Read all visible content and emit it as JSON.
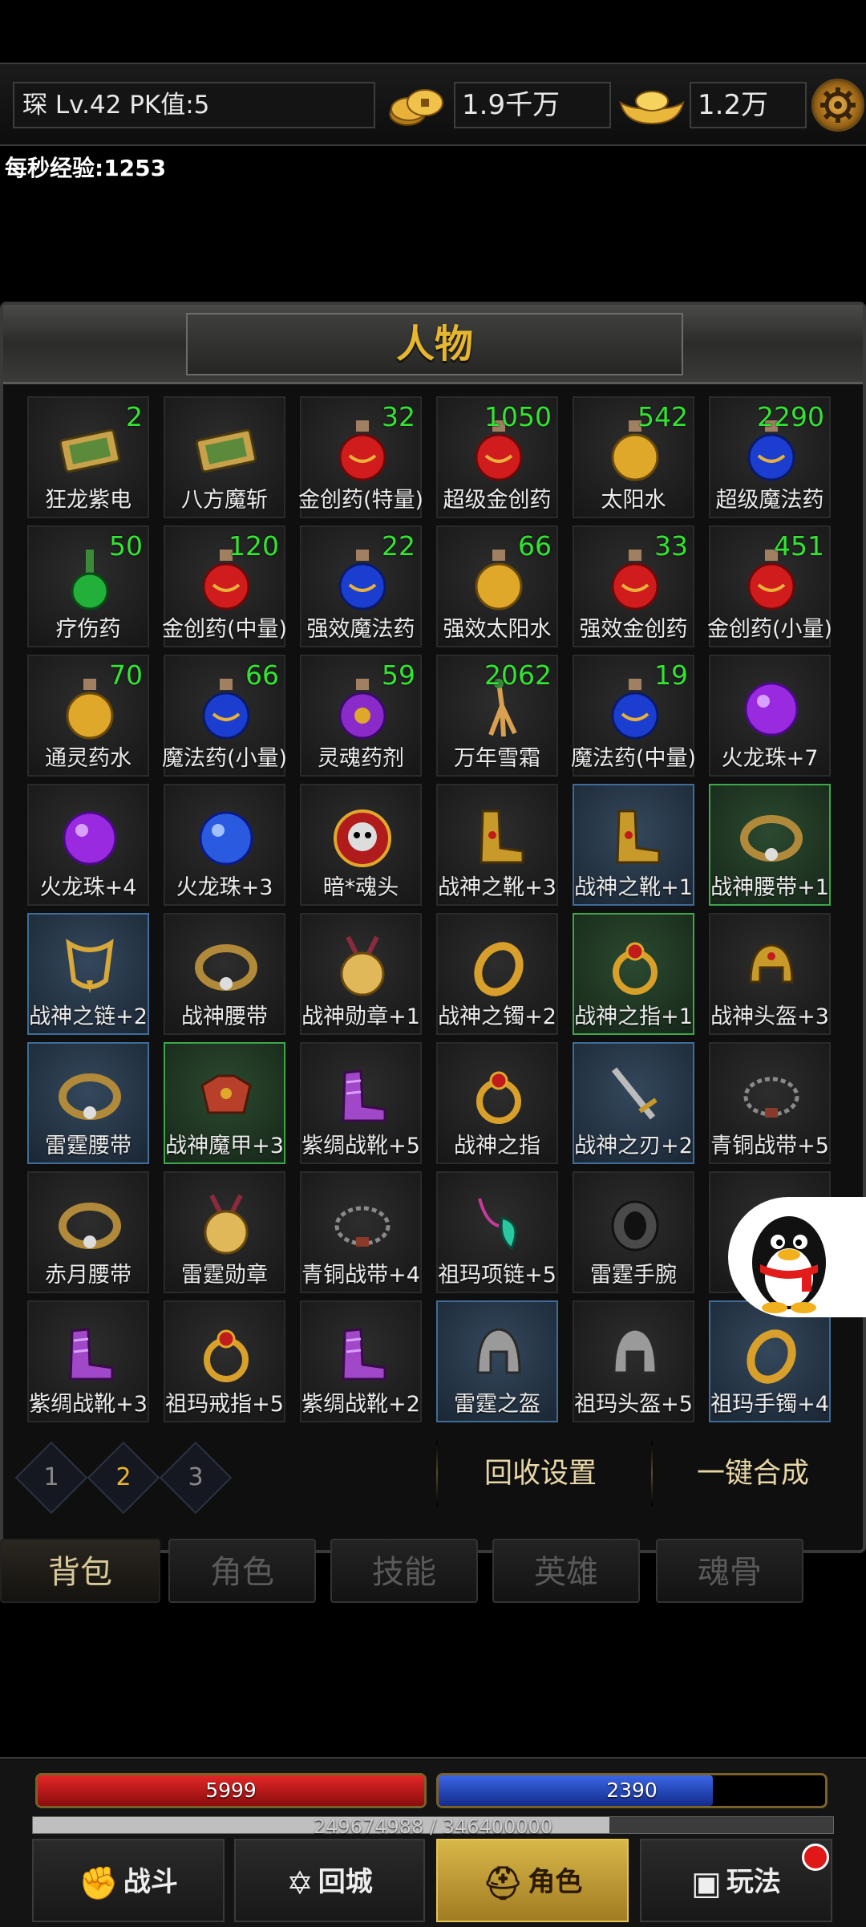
{
  "topbar": {
    "player": "琛  Lv.42 PK值:5",
    "gold": "1.9千万",
    "ingot": "1.2万",
    "icons": {
      "gold": "gold-coins-icon",
      "ingot": "gold-ingot-icon",
      "settings": "gear-icon"
    }
  },
  "exp_rate": "每秒经验:1253",
  "panel": {
    "title": "人物",
    "items": [
      {
        "name": "狂龙紫电",
        "count": "2",
        "icon": "scroll",
        "frame": "normal"
      },
      {
        "name": "八方魔斩",
        "count": "",
        "icon": "scroll",
        "frame": "normal"
      },
      {
        "name": "金创药(特量)",
        "count": "32",
        "icon": "potion-red",
        "frame": "normal"
      },
      {
        "name": "超级金创药",
        "count": "1050",
        "icon": "potion-red",
        "frame": "normal"
      },
      {
        "name": "太阳水",
        "count": "542",
        "icon": "potion-gold",
        "frame": "normal"
      },
      {
        "name": "超级魔法药",
        "count": "2290",
        "icon": "potion-blue",
        "frame": "normal"
      },
      {
        "name": "疗伤药",
        "count": "50",
        "icon": "potion-green",
        "frame": "normal"
      },
      {
        "name": "金创药(中量)",
        "count": "120",
        "icon": "potion-red",
        "frame": "normal"
      },
      {
        "name": "强效魔法药",
        "count": "22",
        "icon": "potion-blue",
        "frame": "normal"
      },
      {
        "name": "强效太阳水",
        "count": "66",
        "icon": "potion-gold",
        "frame": "normal"
      },
      {
        "name": "强效金创药",
        "count": "33",
        "icon": "potion-red",
        "frame": "normal"
      },
      {
        "name": "金创药(小量)",
        "count": "451",
        "icon": "potion-red",
        "frame": "normal"
      },
      {
        "name": "通灵药水",
        "count": "70",
        "icon": "potion-gold",
        "frame": "normal"
      },
      {
        "name": "魔法药(小量)",
        "count": "66",
        "icon": "potion-blue",
        "frame": "normal"
      },
      {
        "name": "灵魂药剂",
        "count": "59",
        "icon": "potion-purple",
        "frame": "normal"
      },
      {
        "name": "万年雪霜",
        "count": "2062",
        "icon": "root",
        "frame": "normal"
      },
      {
        "name": "魔法药(中量)",
        "count": "19",
        "icon": "potion-blue",
        "frame": "normal"
      },
      {
        "name": "火龙珠+7",
        "count": "",
        "icon": "orb-purple",
        "frame": "normal"
      },
      {
        "name": "火龙珠+4",
        "count": "",
        "icon": "orb-purple",
        "frame": "normal"
      },
      {
        "name": "火龙珠+3",
        "count": "",
        "icon": "orb-blue",
        "frame": "normal"
      },
      {
        "name": "暗*魂头",
        "count": "",
        "icon": "skull",
        "frame": "normal"
      },
      {
        "name": "战神之靴+3",
        "count": "",
        "icon": "boots-gold",
        "frame": "normal"
      },
      {
        "name": "战神之靴+1",
        "count": "",
        "icon": "boots-gold",
        "frame": "blue"
      },
      {
        "name": "战神腰带+1",
        "count": "",
        "icon": "belt",
        "frame": "green"
      },
      {
        "name": "战神之链+2",
        "count": "",
        "icon": "necklace",
        "frame": "blue"
      },
      {
        "name": "战神腰带",
        "count": "",
        "icon": "belt",
        "frame": "normal"
      },
      {
        "name": "战神勋章+1",
        "count": "",
        "icon": "medal",
        "frame": "normal"
      },
      {
        "name": "战神之镯+2",
        "count": "",
        "icon": "bracelet",
        "frame": "normal"
      },
      {
        "name": "战神之指+1",
        "count": "",
        "icon": "ring",
        "frame": "green"
      },
      {
        "name": "战神头盔+3",
        "count": "",
        "icon": "helmet-gold",
        "frame": "normal"
      },
      {
        "name": "雷霆腰带",
        "count": "",
        "icon": "belt",
        "frame": "blue"
      },
      {
        "name": "战神魔甲+3",
        "count": "",
        "icon": "armor",
        "frame": "green"
      },
      {
        "name": "紫绸战靴+5",
        "count": "",
        "icon": "boots-purple",
        "frame": "normal"
      },
      {
        "name": "战神之指",
        "count": "",
        "icon": "ring",
        "frame": "normal"
      },
      {
        "name": "战神之刃+2",
        "count": "",
        "icon": "sword",
        "frame": "blue"
      },
      {
        "name": "青铜战带+5",
        "count": "",
        "icon": "chain-belt",
        "frame": "normal"
      },
      {
        "name": "赤月腰带",
        "count": "",
        "icon": "belt",
        "frame": "normal"
      },
      {
        "name": "雷霆勋章",
        "count": "",
        "icon": "medal",
        "frame": "normal"
      },
      {
        "name": "青铜战带+4",
        "count": "",
        "icon": "chain-belt",
        "frame": "normal"
      },
      {
        "name": "祖玛项链+5",
        "count": "",
        "icon": "pendant",
        "frame": "normal"
      },
      {
        "name": "雷霆手腕",
        "count": "",
        "icon": "bracer",
        "frame": "normal"
      },
      {
        "name": "",
        "count": "",
        "icon": "",
        "frame": "normal"
      },
      {
        "name": "紫绸战靴+3",
        "count": "",
        "icon": "boots-purple",
        "frame": "normal"
      },
      {
        "name": "祖玛戒指+5",
        "count": "",
        "icon": "ring",
        "frame": "normal"
      },
      {
        "name": "紫绸战靴+2",
        "count": "",
        "icon": "boots-purple",
        "frame": "normal"
      },
      {
        "name": "雷霆之盔",
        "count": "",
        "icon": "helmet-silver",
        "frame": "blue"
      },
      {
        "name": "祖玛头盔+5",
        "count": "",
        "icon": "helmet-silver",
        "frame": "normal"
      },
      {
        "name": "祖玛手镯+4",
        "count": "",
        "icon": "bracelet",
        "frame": "blue"
      }
    ],
    "pages": [
      "1",
      "2",
      "3"
    ],
    "active_page": "2",
    "recycle_label": "回收设置",
    "combine_label": "一键合成"
  },
  "tabs": [
    {
      "label": "背包",
      "active": true
    },
    {
      "label": "角色",
      "active": false
    },
    {
      "label": "技能",
      "active": false
    },
    {
      "label": "英雄",
      "active": false
    },
    {
      "label": "魂骨",
      "active": false
    }
  ],
  "hud": {
    "hp": "5999",
    "mp": "2390",
    "hp_fraction": 1.0,
    "mp_fraction": 0.71,
    "exp": "249674988 / 346400000",
    "exp_fraction": 0.72,
    "nav": [
      {
        "label": "战斗",
        "icon": "fist-icon",
        "active": false
      },
      {
        "label": "回城",
        "icon": "portal-icon",
        "active": false
      },
      {
        "label": "角色",
        "icon": "helmet-icon",
        "active": true
      },
      {
        "label": "玩法",
        "icon": "treasure-chest-icon",
        "active": false
      }
    ]
  },
  "colors": {
    "accent_gold": "#e6b630",
    "count_green": "#33e433",
    "hp_red": "#c81818",
    "mp_blue": "#1c46c8"
  }
}
